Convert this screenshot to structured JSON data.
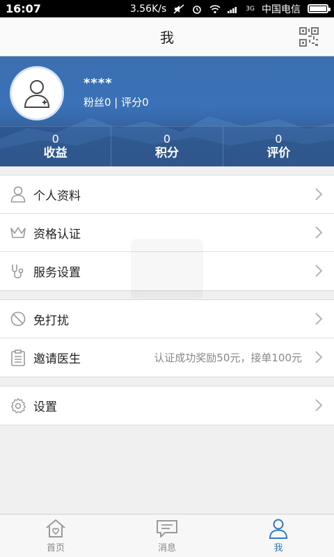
{
  "status_bar": {
    "time": "16:07",
    "speed": "3.56K/s",
    "carrier": "中国电信",
    "network": "3G"
  },
  "header": {
    "title": "我"
  },
  "profile": {
    "name": "****",
    "meta": "粉丝0 | 评分0",
    "stats": [
      {
        "value": "0",
        "label": "收益"
      },
      {
        "value": "0",
        "label": "积分"
      },
      {
        "value": "0",
        "label": "评价"
      }
    ]
  },
  "menu": {
    "group1": [
      {
        "label": "个人资料",
        "icon": "person-icon"
      },
      {
        "label": "资格认证",
        "icon": "crown-icon"
      },
      {
        "label": "服务设置",
        "icon": "stethoscope-icon"
      }
    ],
    "group2": [
      {
        "label": "免打扰",
        "icon": "no-disturb-icon"
      },
      {
        "label": "邀请医生",
        "icon": "clipboard-icon",
        "extra": "认证成功奖励50元，接单100元"
      }
    ],
    "group3": [
      {
        "label": "设置",
        "icon": "gear-icon"
      }
    ]
  },
  "tabbar": {
    "tabs": [
      {
        "label": "首页",
        "active": false
      },
      {
        "label": "消息",
        "active": false
      },
      {
        "label": "我",
        "active": true
      }
    ]
  },
  "colors": {
    "accent": "#2b78c8",
    "hero_blue": "#3a71b8"
  }
}
